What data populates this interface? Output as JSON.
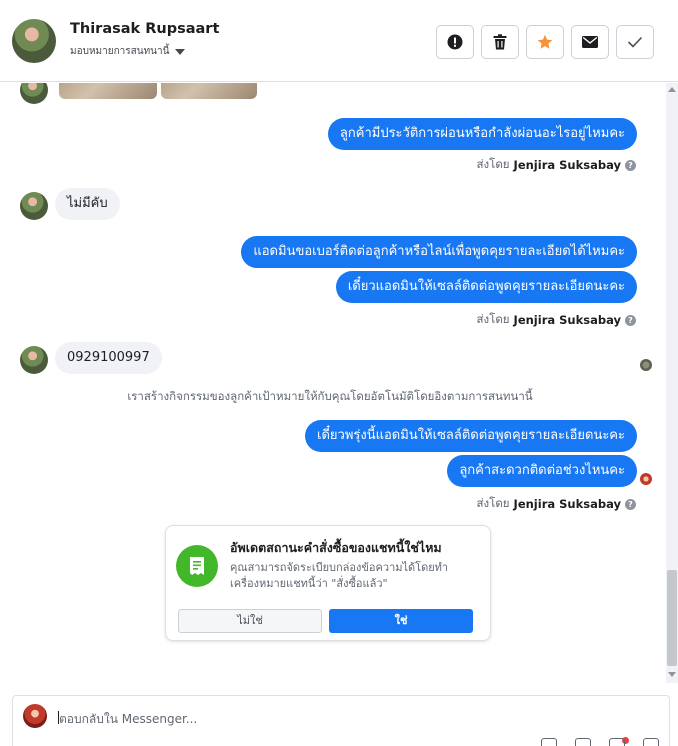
{
  "header": {
    "contact_name": "Thirasak Rupsaart",
    "assign_label": "มอบหมายการสนทนานี้",
    "actions": [
      {
        "icon": "alert-icon"
      },
      {
        "icon": "trash-icon"
      },
      {
        "icon": "star-icon",
        "color": "#f7923b"
      },
      {
        "icon": "mail-icon"
      },
      {
        "icon": "check-icon"
      }
    ]
  },
  "messages": {
    "out1": "ลูกค้ามีประวัติการผ่อนหรือกำลังผ่อนอะไรอยู่ไหมคะ",
    "in1": "ไม่มีคับ",
    "out2": "แอดมินขอเบอร์ติดต่อลูกค้าหรือไลน์เพื่อพูดคุยรายละเอียดได้ไหมคะ",
    "out3": "เดี๋ยวแอดมินให้เซลล์ติดต่อพูดคุยรายละเอียดนะคะ",
    "in2": "0929100997",
    "system_note": "เราสร้างกิจกรรมของลูกค้าเป้าหมายให้กับคุณโดยอัตโนมัติโดยอิงตามการสนทนานี้",
    "out4": "เดี๋ยวพรุ่งนี้แอดมินให้เซลล์ติดต่อพูดคุยรายละเอียดนะคะ",
    "out5": "ลูกค้าสะดวกติดต่อช่วงไหนคะ"
  },
  "sent_by": {
    "prefix": "ส่งโดย",
    "name": "Jenjira Suksabay",
    "help": "?"
  },
  "order_card": {
    "title": "อัพเดตสถานะคำสั่งซื้อของแชทนี้ใช่ไหม",
    "description": "คุณสามารถจัดระเบียบกล่องข้อความได้โดยทำเครื่องหมายแชทนี้ว่า \"สั่งซื้อแล้ว\"",
    "no_label": "ไม่ใช่",
    "yes_label": "ใช่",
    "icon_color": "#42b72a"
  },
  "composer": {
    "placeholder": "ตอบกลับใน Messenger..."
  },
  "colors": {
    "accent": "#1877f2",
    "incoming_bubble": "#f0f2f5"
  }
}
